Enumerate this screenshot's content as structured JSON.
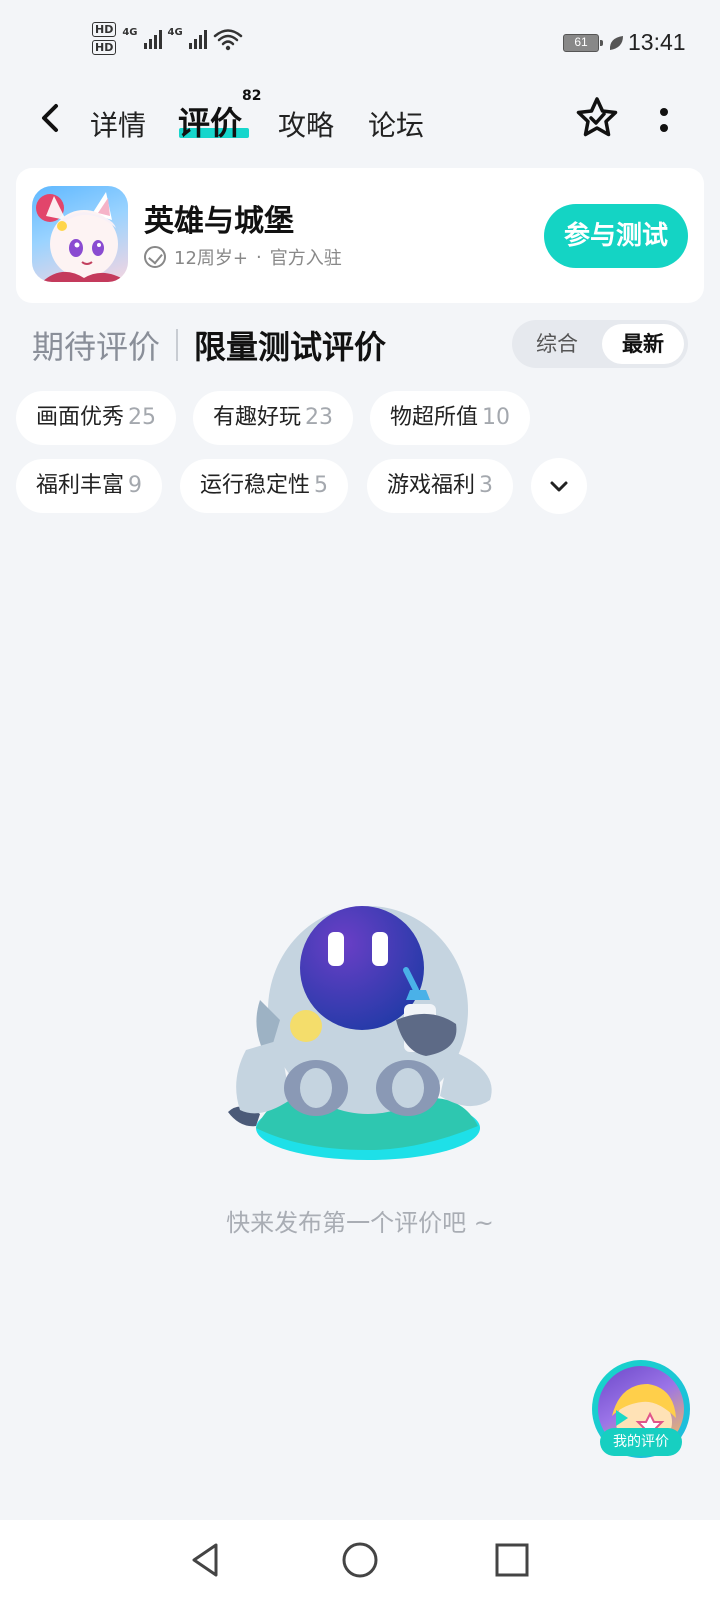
{
  "status_bar": {
    "sim1": "HD",
    "sim2": "HD",
    "network1": "4G",
    "network2": "4G",
    "battery": "61",
    "time": "13:41"
  },
  "nav": {
    "tabs": [
      {
        "label": "详情",
        "active": false
      },
      {
        "label": "评价",
        "active": true,
        "count": "82"
      },
      {
        "label": "攻略",
        "active": false
      },
      {
        "label": "论坛",
        "active": false
      }
    ]
  },
  "app": {
    "title": "英雄与城堡",
    "age_rating": "12周岁+",
    "separator": "·",
    "badge": "官方入驻",
    "join_label": "参与测试"
  },
  "section": {
    "tab_expect": "期待评价",
    "tab_test": "限量测试评价",
    "sort_all": "综合",
    "sort_latest": "最新"
  },
  "tags": [
    {
      "label": "画面优秀",
      "count": "25"
    },
    {
      "label": "有趣好玩",
      "count": "23"
    },
    {
      "label": "物超所值",
      "count": "10"
    },
    {
      "label": "福利丰富",
      "count": "9"
    },
    {
      "label": "运行稳定性",
      "count": "5"
    },
    {
      "label": "游戏福利",
      "count": "3"
    }
  ],
  "empty_state": {
    "message": "快来发布第一个评价吧 ~"
  },
  "fab": {
    "label": "我的评价"
  },
  "colors": {
    "accent": "#14d4c4",
    "background": "#f3f5f8"
  }
}
